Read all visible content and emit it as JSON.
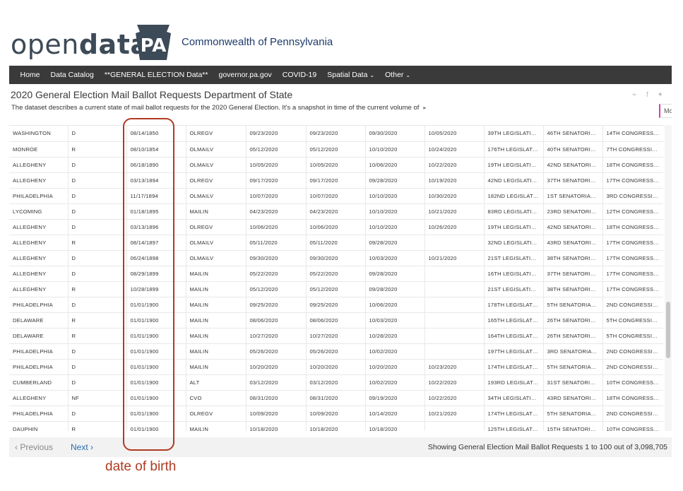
{
  "brand": {
    "logo_regular": "open",
    "logo_bold": "data",
    "badge_text": "PA",
    "commonwealth": "Commonwealth of Pennsylvania"
  },
  "nav": [
    {
      "label": "Home",
      "dropdown": false
    },
    {
      "label": "Data Catalog",
      "dropdown": false
    },
    {
      "label": "**GENERAL ELECTION Data**",
      "dropdown": false
    },
    {
      "label": "governor.pa.gov",
      "dropdown": false
    },
    {
      "label": "COVID-19",
      "dropdown": false
    },
    {
      "label": "Spatial Data",
      "dropdown": true
    },
    {
      "label": "Other",
      "dropdown": true
    }
  ],
  "dataset": {
    "title": "2020 General Election Mail Ballot Requests Department of State",
    "description": "The dataset describes a current state of mail ballot requests for the 2020 General Election. It's a snapshot in time of the current volume of",
    "more_label": "Mor"
  },
  "rows": [
    [
      "WASHINGTON",
      "D",
      "08/14/1850",
      "OLREGV",
      "09/23/2020",
      "09/23/2020",
      "09/30/2020",
      "10/05/2020",
      "39TH LEGISLATIVE...",
      "46TH SENATORIAL...",
      "14TH CONGRESSI..."
    ],
    [
      "MONROE",
      "R",
      "08/10/1854",
      "OLMAILV",
      "05/12/2020",
      "05/12/2020",
      "10/10/2020",
      "10/24/2020",
      "176TH LEGISLATIV...",
      "40TH SENATORIAL...",
      "7TH CONGRESSIO..."
    ],
    [
      "ALLEGHENY",
      "D",
      "06/18/1890",
      "OLMAILV",
      "10/05/2020",
      "10/05/2020",
      "10/06/2020",
      "10/22/2020",
      "19TH LEGISLATIVE...",
      "42ND SENATORIA...",
      "18TH CONGRESSI..."
    ],
    [
      "ALLEGHENY",
      "D",
      "03/13/1894",
      "OLREGV",
      "09/17/2020",
      "09/17/2020",
      "09/28/2020",
      "10/19/2020",
      "42ND LEGISLATIV...",
      "37TH SENATORIAL...",
      "17TH CONGRESSI..."
    ],
    [
      "PHILADELPHIA",
      "D",
      "11/17/1894",
      "OLMAILV",
      "10/07/2020",
      "10/07/2020",
      "10/10/2020",
      "10/30/2020",
      "182ND LEGISLATI...",
      "1ST SENATORIAL ...",
      "3RD CONGRESSIO..."
    ],
    [
      "LYCOMING",
      "D",
      "01/18/1895",
      "MAILIN",
      "04/23/2020",
      "04/23/2020",
      "10/10/2020",
      "10/21/2020",
      "83RD LEGISLATIVE...",
      "23RD SENATORIAL...",
      "12TH CONGRESSI..."
    ],
    [
      "ALLEGHENY",
      "D",
      "03/13/1896",
      "OLREGV",
      "10/06/2020",
      "10/06/2020",
      "10/10/2020",
      "10/26/2020",
      "19TH LEGISLATIVE...",
      "42ND SENATORIA...",
      "18TH CONGRESSI..."
    ],
    [
      "ALLEGHENY",
      "R",
      "08/14/1897",
      "OLMAILV",
      "05/11/2020",
      "05/11/2020",
      "09/28/2020",
      "",
      "32ND LEGISLATIVE...",
      "43RD SENATORIAL...",
      "17TH CONGRESSI..."
    ],
    [
      "ALLEGHENY",
      "D",
      "06/24/1898",
      "OLMAILV",
      "09/30/2020",
      "09/30/2020",
      "10/03/2020",
      "10/21/2020",
      "21ST LEGISLATIVE...",
      "38TH SENATORIAL...",
      "17TH CONGRESSI..."
    ],
    [
      "ALLEGHENY",
      "D",
      "08/29/1899",
      "MAILIN",
      "05/22/2020",
      "05/22/2020",
      "09/28/2020",
      "",
      "16TH LEGISLATIVE...",
      "37TH SENATORIAL...",
      "17TH CONGRESSI..."
    ],
    [
      "ALLEGHENY",
      "R",
      "10/28/1899",
      "MAILIN",
      "05/12/2020",
      "05/12/2020",
      "09/28/2020",
      "",
      "21ST LEGISLATIVE...",
      "38TH SENATORIAL...",
      "17TH CONGRESSI..."
    ],
    [
      "PHILADELPHIA",
      "D",
      "01/01/1900",
      "MAILIN",
      "09/25/2020",
      "09/25/2020",
      "10/06/2020",
      "",
      "178TH LEGISLATIV...",
      "5TH SENATORIAL ...",
      "2ND CONGRESSIO..."
    ],
    [
      "DELAWARE",
      "R",
      "01/01/1900",
      "MAILIN",
      "08/06/2020",
      "08/06/2020",
      "10/03/2020",
      "",
      "165TH LEGISLATIV...",
      "26TH SENATORIAL...",
      "5TH CONGRESSIO..."
    ],
    [
      "DELAWARE",
      "R",
      "01/01/1900",
      "MAILIN",
      "10/27/2020",
      "10/27/2020",
      "10/28/2020",
      "",
      "164TH LEGISLATIV...",
      "26TH SENATORIAL...",
      "5TH CONGRESSIO..."
    ],
    [
      "PHILADELPHIA",
      "D",
      "01/01/1900",
      "MAILIN",
      "05/26/2020",
      "05/26/2020",
      "10/02/2020",
      "",
      "197TH LEGISLATIV...",
      "3RD SENATORIAL ...",
      "2ND CONGRESSIO..."
    ],
    [
      "PHILADELPHIA",
      "D",
      "01/01/1900",
      "MAILIN",
      "10/20/2020",
      "10/20/2020",
      "10/20/2020",
      "10/23/2020",
      "174TH LEGISLATIV...",
      "5TH SENATORIAL ...",
      "2ND CONGRESSIO..."
    ],
    [
      "CUMBERLAND",
      "D",
      "01/01/1900",
      "ALT",
      "03/12/2020",
      "03/12/2020",
      "10/02/2020",
      "10/22/2020",
      "193RD LEGISLATIV...",
      "31ST SENATORIAL...",
      "10TH CONGRESSI..."
    ],
    [
      "ALLEGHENY",
      "NF",
      "01/01/1900",
      "CVO",
      "08/31/2020",
      "08/31/2020",
      "09/19/2020",
      "10/22/2020",
      "34TH LEGISLATIVE...",
      "43RD SENATORIAL...",
      "18TH CONGRESSI..."
    ],
    [
      "PHILADELPHIA",
      "D",
      "01/01/1900",
      "OLREGV",
      "10/09/2020",
      "10/09/2020",
      "10/14/2020",
      "10/21/2020",
      "174TH LEGISLATIV...",
      "5TH SENATORIAL ...",
      "2ND CONGRESSIO..."
    ],
    [
      "DAUPHIN",
      "R",
      "01/01/1900",
      "MAILIN",
      "10/18/2020",
      "10/18/2020",
      "10/18/2020",
      "",
      "125TH LEGISLATIV...",
      "15TH SENATORIAL...",
      "10TH CONGRESSI..."
    ]
  ],
  "footer": {
    "prev_label": "Previous",
    "next_label": "Next",
    "showing": "Showing General Election Mail Ballot Requests 1 to 100 out of 3,098,705"
  },
  "annotation": {
    "label": "date of birth",
    "color": "#b03a22"
  },
  "colors": {
    "navbar": "#3a3a3a",
    "logo": "#3d4a57",
    "accent_link": "#2a6db0",
    "more_border": "#d63bb1"
  }
}
